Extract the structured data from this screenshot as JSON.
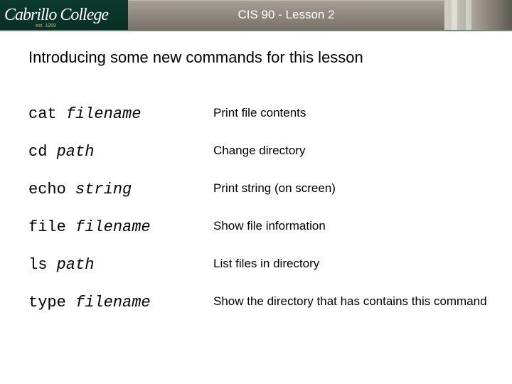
{
  "header": {
    "logo_text": "Cabrillo College",
    "logo_est": "est. 1959",
    "title": "CIS 90 - Lesson 2"
  },
  "intro": "Introducing some new commands for this lesson",
  "commands": [
    {
      "cmd": "cat",
      "arg": "filename",
      "desc": "Print file contents"
    },
    {
      "cmd": "cd",
      "arg": "path",
      "desc": "Change directory"
    },
    {
      "cmd": "echo",
      "arg": "string",
      "desc": "Print string (on screen)"
    },
    {
      "cmd": "file",
      "arg": "filename",
      "desc": "Show file information"
    },
    {
      "cmd": "ls",
      "arg": "path",
      "desc": "List files in directory"
    },
    {
      "cmd": "type",
      "arg": "filename",
      "desc": "Show the directory that has contains this command"
    }
  ]
}
